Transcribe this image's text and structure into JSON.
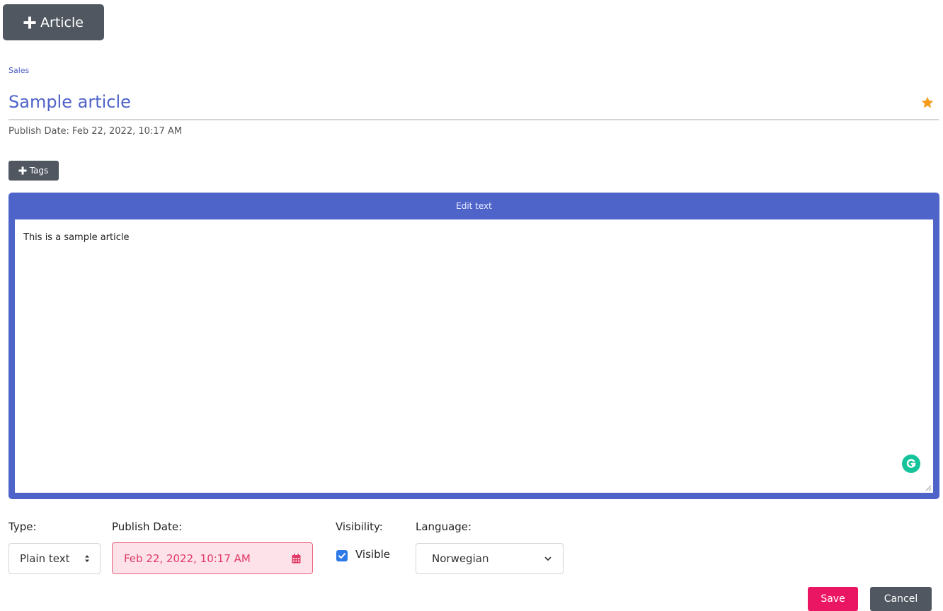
{
  "toolbar": {
    "add_article_label": "Article"
  },
  "breadcrumb": "Sales",
  "article": {
    "title": "Sample article",
    "publish_meta": "Publish Date: Feb 22, 2022, 10:17 AM",
    "favorite_icon": "star-icon",
    "favorite_color": "#f59c1a"
  },
  "tags": {
    "button_label": "Tags"
  },
  "editor": {
    "header": "Edit text",
    "content": "This is a sample article",
    "accent_color": "#4f64c9"
  },
  "form": {
    "type": {
      "label": "Type:",
      "selected": "Plain text"
    },
    "publish_date": {
      "label": "Publish Date:",
      "value": "Feb 22, 2022, 10:17 AM"
    },
    "visibility": {
      "label": "Visibility:",
      "option_label": "Visible",
      "checked": true
    },
    "language": {
      "label": "Language:",
      "selected": "Norwegian"
    }
  },
  "actions": {
    "save_label": "Save",
    "cancel_label": "Cancel",
    "save_color": "#ea1663"
  }
}
